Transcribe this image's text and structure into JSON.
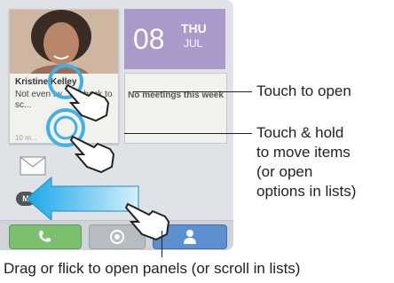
{
  "contact": {
    "name": "Kristine Kelley",
    "status": "Not even tw... go back to sc...",
    "time": "10 m..."
  },
  "date_widget": {
    "day": "08",
    "weekday": "THU",
    "month": "JUL"
  },
  "calendar": {
    "text": "No meetings this week"
  },
  "badge": "M",
  "callouts": {
    "touch_open": "Touch to open",
    "touch_hold_1": "Touch & hold",
    "touch_hold_2": "to move items",
    "touch_hold_3": "(or open",
    "touch_hold_4": "options in lists)",
    "drag": "Drag or flick to open panels (or scroll in lists)"
  },
  "colors": {
    "date_purple": "#a99acb",
    "phone_green": "#7cbf6e",
    "contacts_blue": "#5b8fd0",
    "highlight_blue": "#3fb0e8"
  }
}
